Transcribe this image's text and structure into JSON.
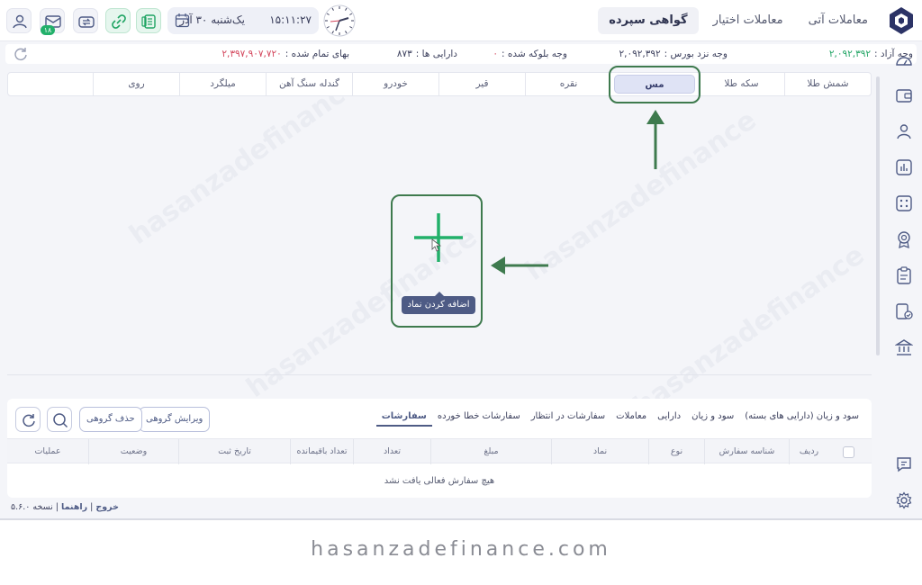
{
  "top_tabs": [
    "معاملات آتی",
    "معاملات اختیار",
    "گواهی سپرده"
  ],
  "active_top_tab": "گواهی سپرده",
  "datetime": {
    "time": "۱۵:۱۱:۲۷",
    "date": "یک‌شنبه ۳۰ آذر"
  },
  "messages_badge": "۱۸",
  "info": {
    "free_cash_label": "وجه آزاد :",
    "free_cash_value": "۲,۰۹۲,۳۹۲",
    "broker_cash_label": "وجه نزد بورس :",
    "broker_cash_value": "۲,۰۹۲,۳۹۲",
    "blocked_label": "وجه بلوکه شده :",
    "blocked_value": "۰",
    "assets_label": "دارایی ها :",
    "assets_value": "۸۷۳",
    "cost_label": "بهای تمام شده :",
    "cost_value": "۲,۳۹۷,۹۰۷,۷۲۰"
  },
  "commodity_tabs": [
    "شمش طلا",
    "سکه طلا",
    "مس",
    "نقره",
    "قیر",
    "خودرو",
    "گندله سنگ آهن",
    "میلگرد",
    "روی",
    ""
  ],
  "active_commodity": "مس",
  "add_symbol_tooltip": "اضافه کردن نماد",
  "orders": {
    "tabs": [
      "سفارشات",
      "سفارشات خطا خورده",
      "سفارشات در انتظار",
      "معاملات",
      "دارایی",
      "سود و زیان",
      "سود و زیان (دارایی های بسته)"
    ],
    "active_tab": "سفارشات",
    "group_edit_label": "ویرایش گروهی",
    "group_delete_label": "حذف گروهی",
    "columns": [
      "ردیف",
      "شناسه سفارش",
      "نوع",
      "نماد",
      "مبلغ",
      "تعداد",
      "تعداد باقیمانده",
      "تاریخ ثبت",
      "وضعیت",
      "عملیات"
    ],
    "empty_message": "هیچ سفارش فعالی یافت نشد"
  },
  "footer": {
    "logout": "خروج",
    "help": "راهنما",
    "version": "نسخه ۵.۶.۰"
  },
  "watermark_site": "hasanzadefinance.com",
  "colors": {
    "accent": "#4e5b85",
    "positive": "#1fa463",
    "negative": "#d3455b",
    "annotation": "#3e7a4e",
    "plus": "#22b06a"
  }
}
